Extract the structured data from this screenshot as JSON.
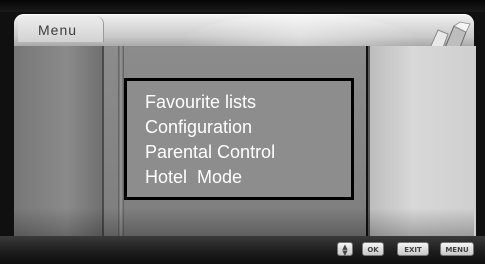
{
  "header": {
    "title": "Menu"
  },
  "menu": {
    "items": [
      {
        "label": "Favourite lists"
      },
      {
        "label": "Configuration"
      },
      {
        "label": "Parental Control"
      },
      {
        "label": "Hotel  Mode"
      }
    ]
  },
  "footer": {
    "buttons": {
      "updown_icon": "up-down-arrows-icon",
      "ok_label": "OK",
      "exit_label": "EXIT",
      "menu_label": "MENU"
    }
  },
  "colors": {
    "menu_text": "#ffffff",
    "menu_border": "#000000",
    "menu_background": "#8d8d8d"
  }
}
